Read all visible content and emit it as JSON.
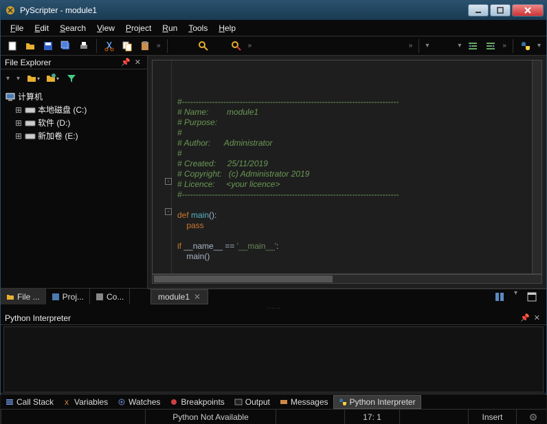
{
  "title": "PyScripter - module1",
  "menu": {
    "file": "File",
    "edit": "Edit",
    "search": "Search",
    "view": "View",
    "project": "Project",
    "run": "Run",
    "tools": "Tools",
    "help": "Help"
  },
  "fileExplorer": {
    "title": "File Explorer",
    "root": "计算机",
    "items": [
      "本地磁盘 (C:)",
      "软件 (D:)",
      "新加卷 (E:)"
    ]
  },
  "bottomTabs": {
    "file": "File ...",
    "proj": "Proj...",
    "co": "Co..."
  },
  "editorTab": "module1",
  "code": {
    "l1": "#-------------------------------------------------------------------------------",
    "l2": "# Name:        module1",
    "l3": "# Purpose:",
    "l4": "#",
    "l5": "# Author:      Administrator",
    "l6": "#",
    "l7": "# Created:     25/11/2019",
    "l8": "# Copyright:   (c) Administrator 2019",
    "l9": "# Licence:     <your licence>",
    "l10": "#-------------------------------------------------------------------------------",
    "def": "def ",
    "main": "main",
    "parens": "():",
    "pass": "    pass",
    "if": "if ",
    "name": "__name__",
    "eq": " == ",
    "mainstr": "'__main__'",
    "colon": ":",
    "call": "    main",
    "callp": "()"
  },
  "interpreter": {
    "title": "Python Interpreter"
  },
  "statusTabs": {
    "callstack": "Call Stack",
    "variables": "Variables",
    "watches": "Watches",
    "breakpoints": "Breakpoints",
    "output": "Output",
    "messages": "Messages",
    "interpreter": "Python Interpreter"
  },
  "status": {
    "python": "Python Not Available",
    "pos": "17:  1",
    "mode": "Insert"
  }
}
